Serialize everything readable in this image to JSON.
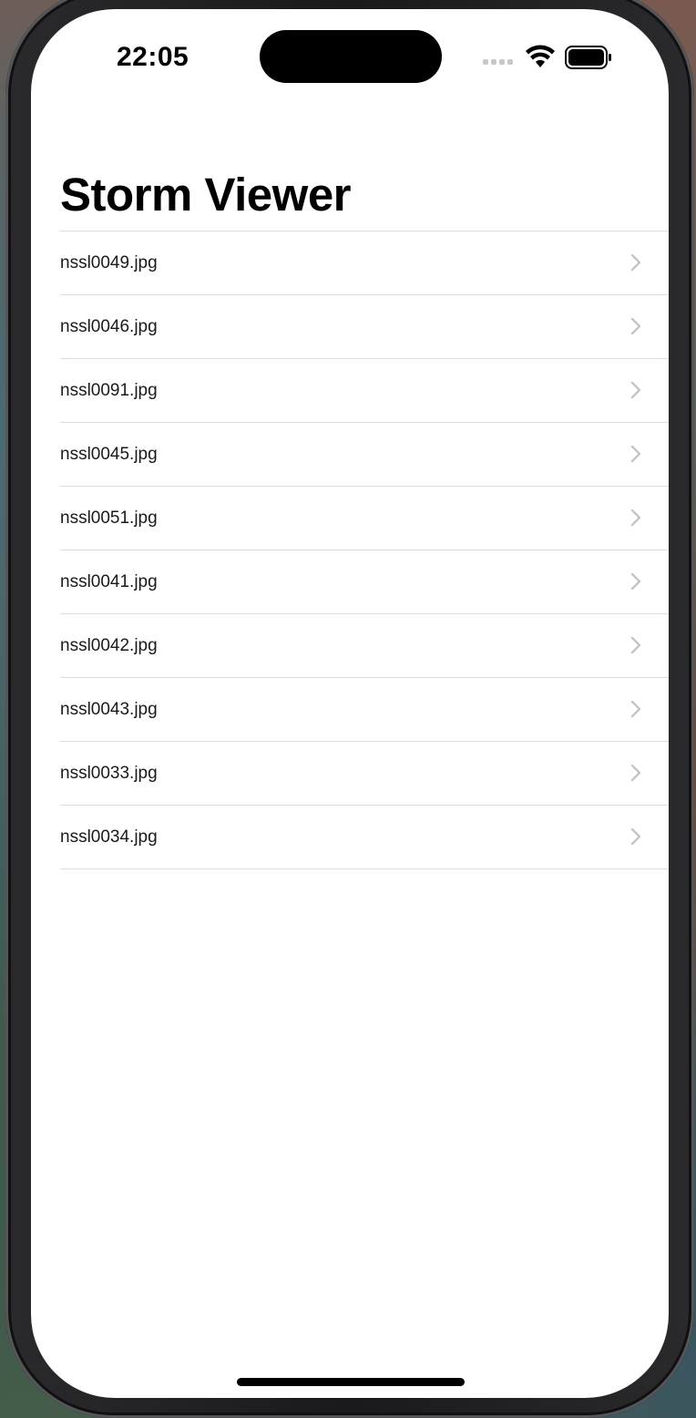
{
  "status_bar": {
    "time": "22:05"
  },
  "navigation": {
    "title": "Storm Viewer"
  },
  "list": {
    "items": [
      {
        "label": "nssl0049.jpg"
      },
      {
        "label": "nssl0046.jpg"
      },
      {
        "label": "nssl0091.jpg"
      },
      {
        "label": "nssl0045.jpg"
      },
      {
        "label": "nssl0051.jpg"
      },
      {
        "label": "nssl0041.jpg"
      },
      {
        "label": "nssl0042.jpg"
      },
      {
        "label": "nssl0043.jpg"
      },
      {
        "label": "nssl0033.jpg"
      },
      {
        "label": "nssl0034.jpg"
      }
    ],
    "accessory_icon": "chevron-right-icon"
  },
  "colors": {
    "background": "#ffffff",
    "separator": "#dcdcdf",
    "chevron": "#c4c4c7",
    "text": "#1a1a1a",
    "title": "#000000"
  }
}
